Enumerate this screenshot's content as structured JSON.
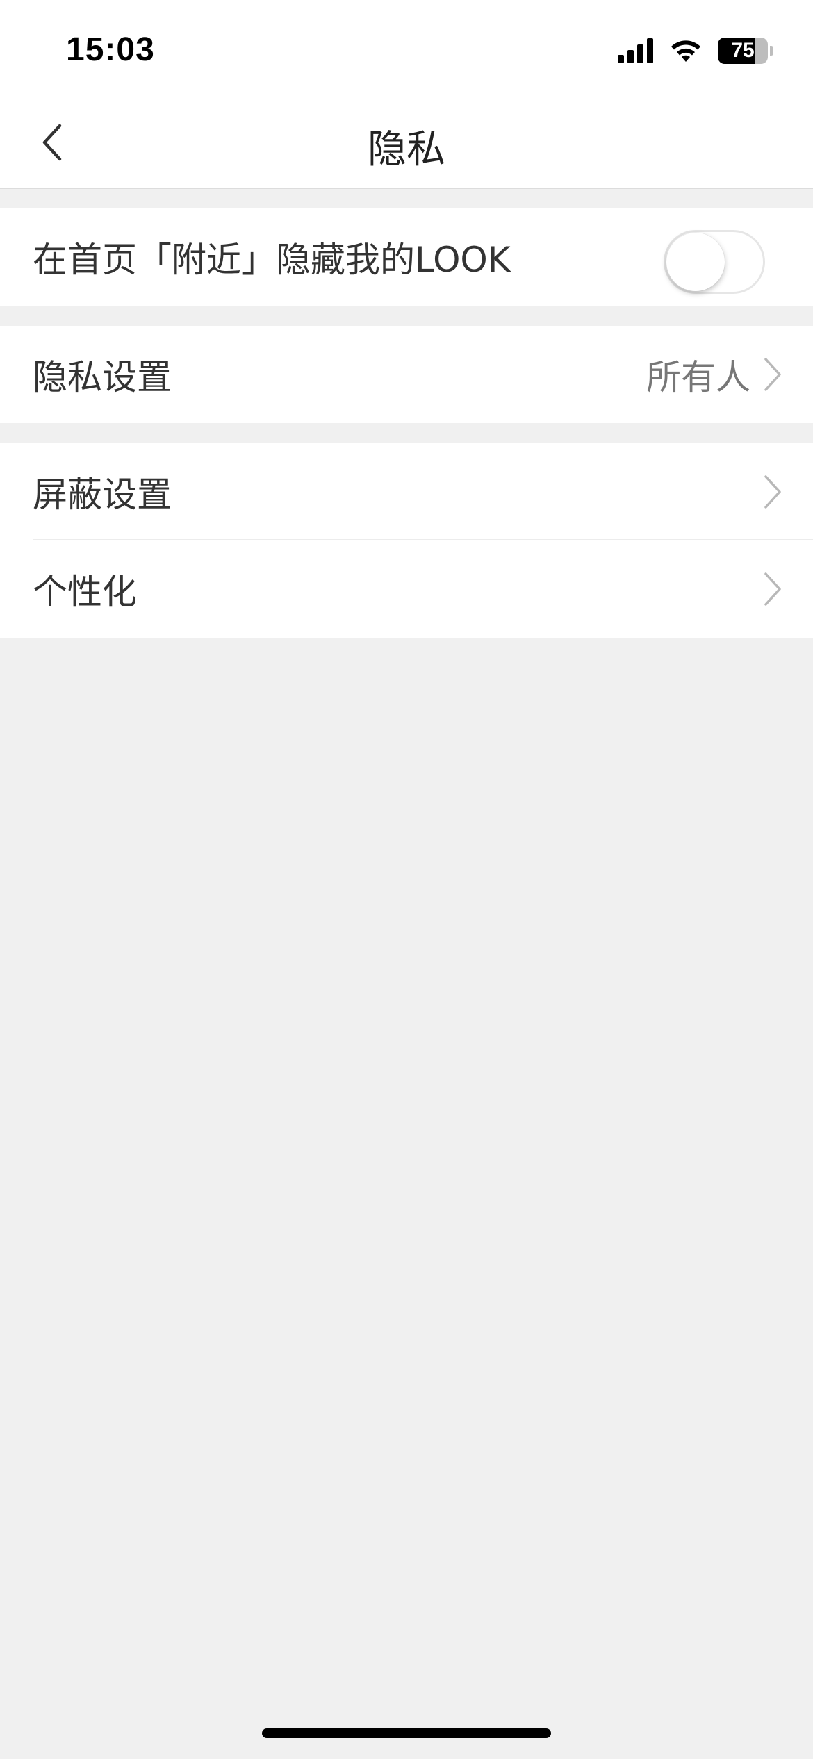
{
  "status_bar": {
    "time": "15:03",
    "battery_level": "75",
    "battery_fraction": 0.75
  },
  "nav": {
    "title": "隐私",
    "back_icon": "chevron-left-icon"
  },
  "settings": {
    "hide_nearby": {
      "label": "在首页「附近」隐藏我的LOOK",
      "enabled": false
    },
    "privacy_settings": {
      "label": "隐私设置",
      "value": "所有人"
    },
    "block_settings": {
      "label": "屏蔽设置"
    },
    "personalization": {
      "label": "个性化"
    }
  },
  "colors": {
    "page_background": "#f0f0f0",
    "surface": "#ffffff",
    "text_primary": "#333333",
    "text_secondary": "#777777",
    "chevron": "#b8b8b8"
  }
}
